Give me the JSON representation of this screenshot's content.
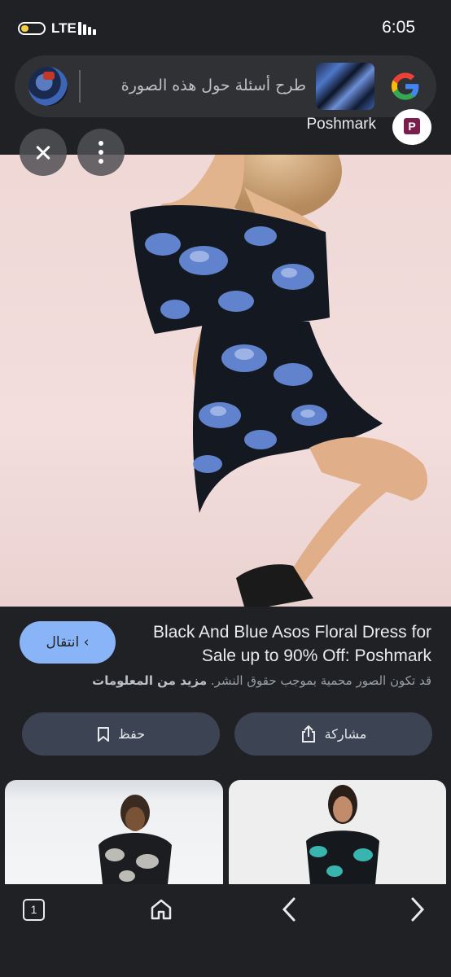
{
  "status_bar": {
    "network": "LTE",
    "time": "6:05",
    "battery_level": 0.35
  },
  "search": {
    "prompt": "طرح أسئلة حول هذه الصورة"
  },
  "source": {
    "name": "Poshmark"
  },
  "result": {
    "title": "Black And Blue Asos Floral Dress for Sale up to 90% Off: Poshmark",
    "visit_label": "انتقال",
    "copyright_note": "قد تكون الصور محمية بموجب حقوق النشر.",
    "learn_more": "مزيد من المعلومات"
  },
  "actions": {
    "save_label": "حفظ",
    "share_label": "مشاركة"
  },
  "bottom_nav": {
    "tab_count": "1"
  },
  "colors": {
    "background": "#202124",
    "accent": "#8ab4f8",
    "button": "#3c4454",
    "searchbar": "#303134"
  }
}
